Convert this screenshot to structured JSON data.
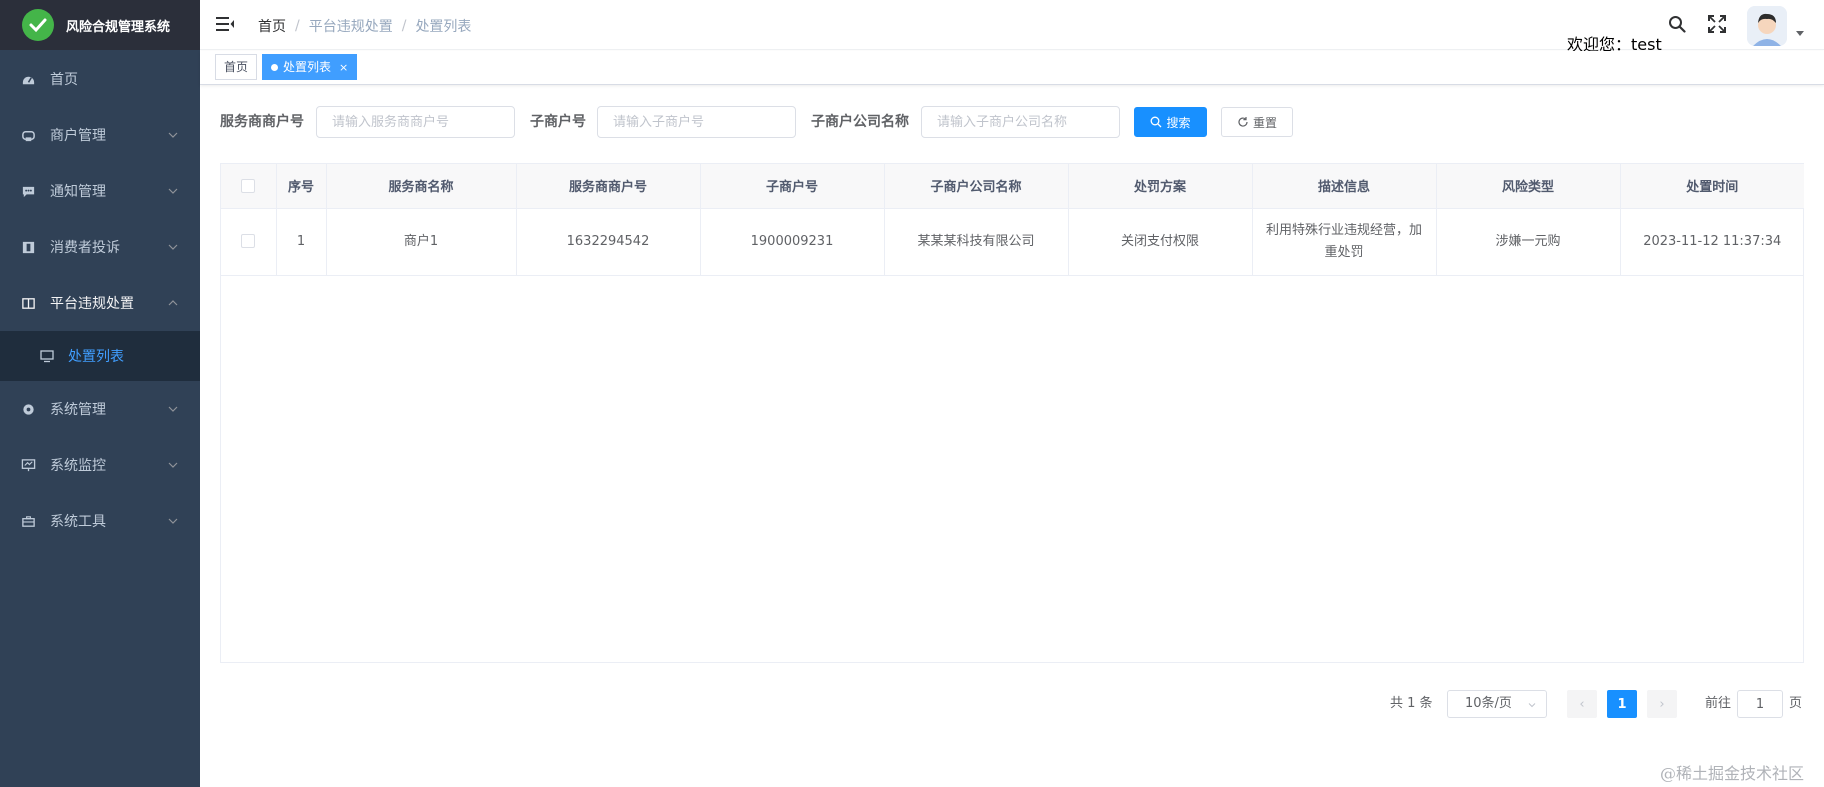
{
  "app": {
    "title": "风险合规管理系统"
  },
  "sidebar": {
    "items": [
      {
        "label": "首页",
        "icon": "dashboard-icon"
      },
      {
        "label": "商户管理",
        "icon": "merchant-icon"
      },
      {
        "label": "通知管理",
        "icon": "message-icon"
      },
      {
        "label": "消费者投诉",
        "icon": "complaint-icon"
      },
      {
        "label": "平台违规处置",
        "icon": "table-icon"
      },
      {
        "label": "系统管理",
        "icon": "gear-icon"
      },
      {
        "label": "系统监控",
        "icon": "monitor-icon"
      },
      {
        "label": "系统工具",
        "icon": "toolbox-icon"
      }
    ],
    "sub_item": {
      "label": "处置列表",
      "icon": "monitor-icon"
    }
  },
  "navbar": {
    "breadcrumb": [
      "首页",
      "平台违规处置",
      "处置列表"
    ],
    "welcome": "欢迎您：test"
  },
  "tags": {
    "home": "首页",
    "active": "处置列表",
    "close": "×"
  },
  "search": {
    "service_no_label": "服务商商户号",
    "service_no_placeholder": "请输入服务商商户号",
    "sub_no_label": "子商户号",
    "sub_no_placeholder": "请输入子商户号",
    "sub_name_label": "子商户公司名称",
    "sub_name_placeholder": "请输入子商户公司名称",
    "search_button": "搜索",
    "reset_button": "重置"
  },
  "table": {
    "headers": [
      "序号",
      "服务商名称",
      "服务商商户号",
      "子商户号",
      "子商户公司名称",
      "处罚方案",
      "描述信息",
      "风险类型",
      "处置时间"
    ],
    "rows": [
      [
        "1",
        "商户1",
        "1632294542",
        "1900009231",
        "某某某科技有限公司",
        "关闭支付权限",
        "利用特殊行业违规经营，加重处罚",
        "涉嫌一元购",
        "2023-11-12 11:37:34"
      ]
    ]
  },
  "pagination": {
    "total": "共 1 条",
    "page_size": "10条/页",
    "current": "1",
    "goto_label": "前往",
    "goto_value": "1",
    "page_word": "页",
    "prev": "‹",
    "next": "›"
  },
  "watermark": "@稀土掘金技术社区",
  "colors": {
    "primary": "#1890ff",
    "sidebar_bg": "#304156",
    "logo_bg": "#2b2f3a",
    "submenu_bg": "#1f2d3d",
    "active_text": "#409eff"
  }
}
